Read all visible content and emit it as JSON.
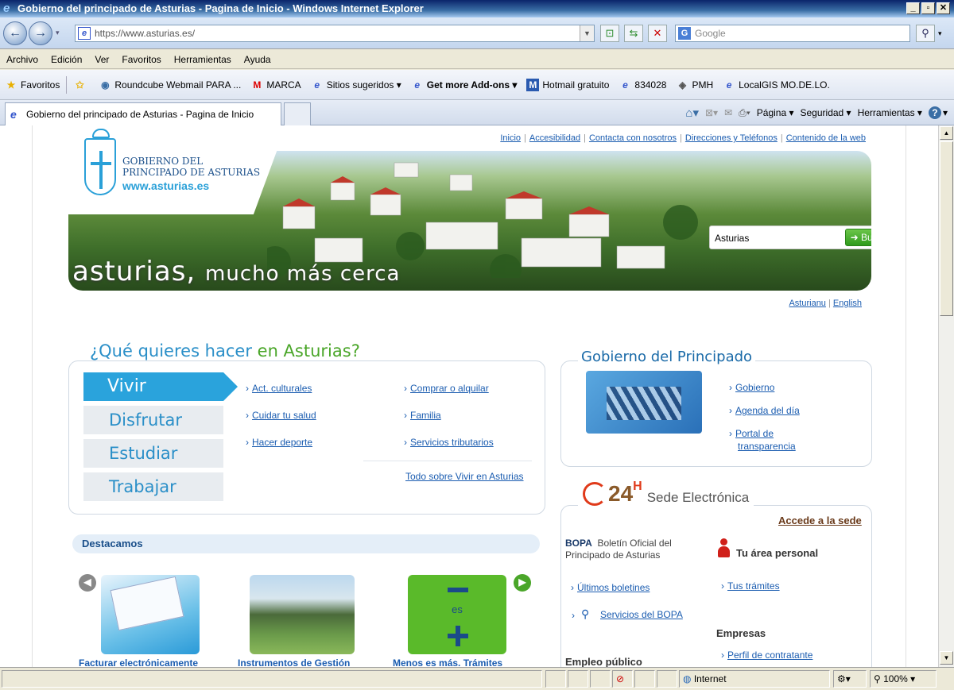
{
  "window": {
    "title": "Gobierno del principado de Asturias - Pagina de Inicio - Windows Internet Explorer"
  },
  "address": {
    "url": "https://www.asturias.es/",
    "search_placeholder": "Google"
  },
  "menu": [
    "Archivo",
    "Edición",
    "Ver",
    "Favoritos",
    "Herramientas",
    "Ayuda"
  ],
  "favorites": {
    "label": "Favoritos",
    "items": [
      "Roundcube Webmail PARA ...",
      "MARCA",
      "Sitios sugeridos ▾",
      "Get more Add-ons ▾",
      "Hotmail gratuito",
      "834028",
      "PMH",
      "LocalGIS MO.DE.LO."
    ]
  },
  "tab": {
    "title": "Gobierno del principado de Asturias - Pagina de Inicio"
  },
  "commands": [
    "Página ▾",
    "Seguridad ▾",
    "Herramientas ▾"
  ],
  "status": {
    "zone": "Internet",
    "zoom": "100%"
  },
  "site": {
    "toplinks": [
      "Inicio",
      "Accesibilidad",
      "Contacta con nosotros",
      "Direcciones y Teléfonos",
      "Contenido de la web"
    ],
    "logo": {
      "line1": "GOBIERNO DEL",
      "line2": "PRINCIPADO DE ASTURIAS",
      "web": "www.asturias.es"
    },
    "slogan_a": "asturias,",
    "slogan_b": "mucho más cerca",
    "search": {
      "value": "Asturias",
      "button": "➜ Buscar"
    },
    "lang": [
      "Asturianu",
      "English"
    ],
    "que_hacer": {
      "title_a": "¿Qué quieres hacer",
      "title_b": "en Asturias?",
      "menu": [
        "Vivir",
        "Disfrutar",
        "Estudiar",
        "Trabajar"
      ],
      "links_col1": [
        "Act. culturales",
        "Cuidar tu salud",
        "Hacer deporte"
      ],
      "links_col2": [
        "Comprar o alquilar",
        "Familia",
        "Servicios tributarios"
      ],
      "todo": "Todo sobre Vivir en Asturias"
    },
    "gobierno": {
      "title": "Gobierno del Principado",
      "links": [
        "Gobierno",
        "Agenda del día",
        "Portal de",
        "transparencia"
      ]
    },
    "sede": {
      "num": "24",
      "h": "H",
      "title": "Sede Electrónica",
      "accede": "Accede a la sede",
      "bopa": "BOPA",
      "bopa_desc1": "Boletín Oficial del",
      "bopa_desc2": "Principado de Asturias",
      "ultimos": "Últimos boletines",
      "servicios": "Servicios del BOPA",
      "empleo": "Empleo público",
      "area": "Tu área personal",
      "tramites": "Tus trámites",
      "empresas": "Empresas",
      "perfil": "Perfil de contratante"
    },
    "destacamos": {
      "title": "Destacamos",
      "items": [
        "Facturar electrónicamente",
        "Instrumentos de Gestión",
        "Menos es más. Trámites"
      ],
      "es_label": "es"
    }
  }
}
